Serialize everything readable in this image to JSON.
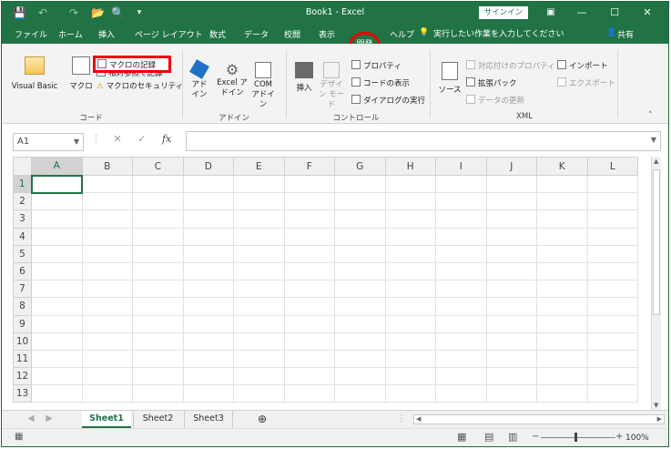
{
  "titlebar": {
    "doc_title": "Book1  -  Excel",
    "signin_label": "サインイン"
  },
  "tabs": [
    "ファイル",
    "ホーム",
    "挿入",
    "ページ レイアウト",
    "数式",
    "データ",
    "校閲",
    "表示",
    "開発",
    "ヘルプ"
  ],
  "active_tab": "開発",
  "tellme": "実行したい作業を入力してください",
  "share": "共有",
  "ribbon": {
    "code": {
      "visual_basic": "Visual Basic",
      "macro": "マクロ",
      "record_macro": "マクロの記録",
      "relative_ref": "相対参照で記録",
      "macro_security": "マクロのセキュリティ",
      "group_label": "コード"
    },
    "addins": {
      "addin": "アド イン",
      "excel_addin": "Excel アドイン",
      "com_addin": "COM アドイン",
      "group_label": "アドイン"
    },
    "controls": {
      "insert": "挿入",
      "design_mode": "デザイン モード",
      "properties": "プロパティ",
      "view_code": "コードの表示",
      "run_dialog": "ダイアログの実行",
      "group_label": "コントロール"
    },
    "xml": {
      "source": "ソース",
      "map_props": "対応付けのプロパティ",
      "expansion_packs": "拡張パック",
      "refresh_data": "データの更新",
      "import": "インポート",
      "export": "エクスポート",
      "group_label": "XML"
    }
  },
  "namebox": "A1",
  "fx": "fx",
  "columns": [
    "A",
    "B",
    "C",
    "D",
    "E",
    "F",
    "G",
    "H",
    "I",
    "J",
    "K",
    "L"
  ],
  "rows": [
    "1",
    "2",
    "3",
    "4",
    "5",
    "6",
    "7",
    "8",
    "9",
    "10",
    "11",
    "12",
    "13"
  ],
  "sheets": [
    "Sheet1",
    "Sheet2",
    "Sheet3"
  ],
  "zoom": "100%",
  "colors": {
    "accent": "#217346",
    "highlight": "#e00000"
  }
}
